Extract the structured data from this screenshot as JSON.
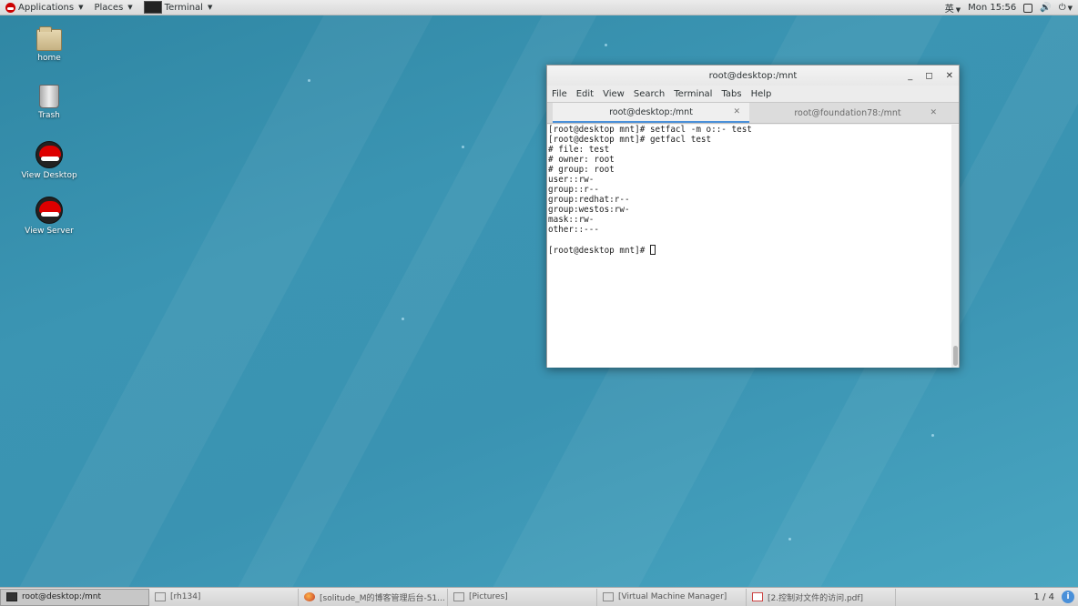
{
  "topbar": {
    "applications_label": "Applications",
    "places_label": "Places",
    "terminal_label": "Terminal",
    "input_method": "英",
    "clock": "Mon 15:56"
  },
  "desktop_icons": [
    {
      "label": "home",
      "icon": "folder-home-icon"
    },
    {
      "label": "Trash",
      "icon": "trash-icon"
    },
    {
      "label": "View Desktop",
      "icon": "redhat-icon"
    },
    {
      "label": "View Server",
      "icon": "redhat-icon"
    }
  ],
  "terminal": {
    "title": "root@desktop:/mnt",
    "menu": [
      "File",
      "Edit",
      "View",
      "Search",
      "Terminal",
      "Tabs",
      "Help"
    ],
    "tabs": [
      {
        "label": "root@desktop:/mnt",
        "active": true
      },
      {
        "label": "root@foundation78:/mnt",
        "active": false
      }
    ],
    "lines": [
      "[root@desktop mnt]# setfacl -m o::- test",
      "[root@desktop mnt]# getfacl test",
      "# file: test",
      "# owner: root",
      "# group: root",
      "user::rw-",
      "group::r--",
      "group:redhat:r--",
      "group:westos:rw-",
      "mask::rw-",
      "other::---",
      ""
    ],
    "prompt": "[root@desktop mnt]# "
  },
  "taskbar": {
    "tasks": [
      {
        "label": "root@desktop:/mnt",
        "icon": "terminal-icon",
        "active": true
      },
      {
        "label": "[rh134]",
        "icon": "window-icon",
        "active": false
      },
      {
        "label": "[solitude_M的博客管理后台-51...",
        "icon": "firefox-icon",
        "active": false
      },
      {
        "label": "[Pictures]",
        "icon": "folder-icon",
        "active": false
      },
      {
        "label": "[Virtual Machine Manager]",
        "icon": "vm-manager-icon",
        "active": false
      },
      {
        "label": "[2.控制对文件的访问.pdf]",
        "icon": "pdf-icon",
        "active": false
      }
    ],
    "workspace": "1 / 4"
  }
}
